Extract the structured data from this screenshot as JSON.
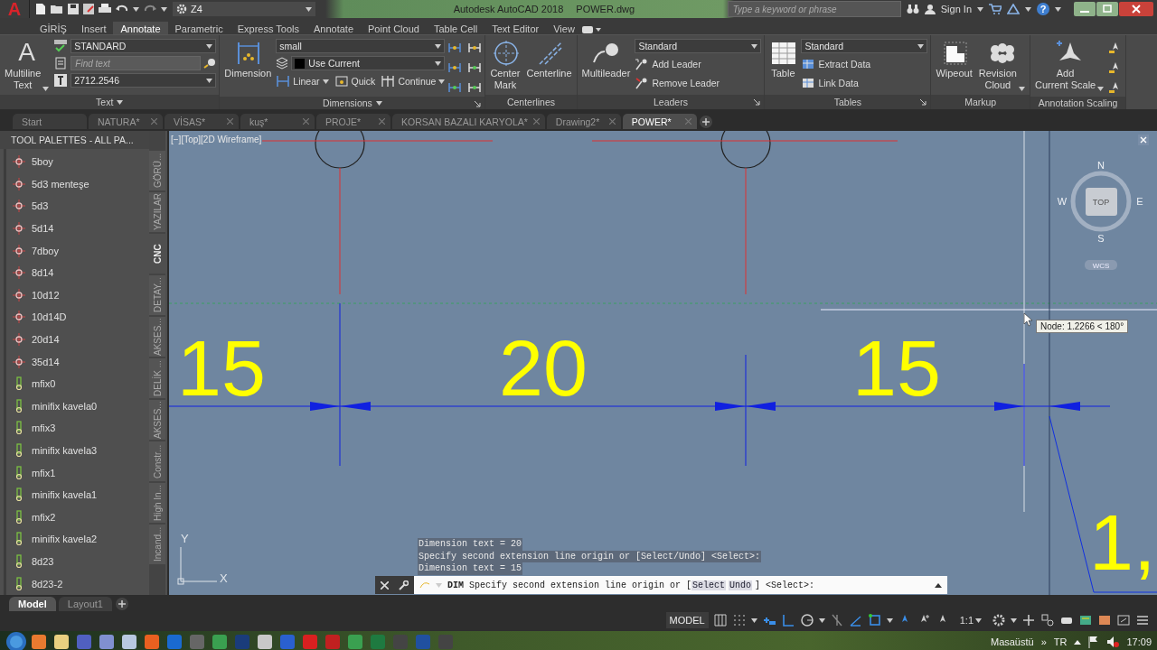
{
  "title_bar": {
    "app_button": "A",
    "workspace": "Z4",
    "title": "Autodesk AutoCAD 2018",
    "file": "POWER.dwg",
    "search": {
      "placeholder": "Type a keyword or phrase"
    },
    "sign_in": "Sign In",
    "help": "?"
  },
  "ribbon_tabs": [
    {
      "label": "GİRİŞ",
      "selected": false
    },
    {
      "label": "Insert",
      "selected": false
    },
    {
      "label": "Annotate",
      "selected": true
    },
    {
      "label": "Parametric",
      "selected": false
    },
    {
      "label": "Express Tools",
      "selected": false
    },
    {
      "label": "Annotate",
      "selected": false
    },
    {
      "label": "Point Cloud",
      "selected": false
    },
    {
      "label": "Table Cell",
      "selected": false
    },
    {
      "label": "Text Editor",
      "selected": false
    },
    {
      "label": "View",
      "selected": false
    }
  ],
  "ribbon_panels": [
    {
      "title": "Text",
      "menu": true,
      "launcher": false,
      "groups": [
        {
          "kind": "large",
          "glyph": "A",
          "label": "Multiline\nText",
          "menu": true
        },
        {
          "kind": "stack",
          "leading_icons": true,
          "rows": [
            {
              "kind": "dropdown",
              "value": "STANDARD"
            },
            {
              "kind": "search",
              "placeholder": "Find text"
            },
            {
              "kind": "dropdown",
              "value": "2712.2546"
            }
          ]
        }
      ]
    },
    {
      "title": "Dimensions",
      "menu": true,
      "launcher": true,
      "groups": [
        {
          "kind": "large",
          "label": "Dimension",
          "menu": false
        },
        {
          "kind": "stack",
          "leading_icons": false,
          "rows": [
            {
              "kind": "dropdown",
              "value": "small"
            },
            {
              "kind": "dropdown",
              "value": "Use Current",
              "color": "#000000"
            },
            {
              "kind": "tools",
              "items": [
                {
                  "label": "Linear",
                  "menu": true
                },
                {
                  "label": "Quick",
                  "menu": false
                },
                {
                  "label": "Continue",
                  "menu": true
                }
              ]
            }
          ]
        },
        {
          "kind": "icon_grid"
        }
      ]
    },
    {
      "title": "Centerlines",
      "menu": false,
      "launcher": false,
      "groups": [
        {
          "kind": "large",
          "label": "Center\nMark",
          "menu": false
        },
        {
          "kind": "large",
          "label": "Centerline",
          "menu": false
        }
      ]
    },
    {
      "title": "Leaders",
      "menu": false,
      "launcher": true,
      "groups": [
        {
          "kind": "large",
          "label": "Multileader",
          "menu": false
        },
        {
          "kind": "stack",
          "leading_icons": false,
          "rows": [
            {
              "kind": "dropdown",
              "value": "Standard"
            },
            {
              "kind": "tools",
              "items": [
                {
                  "label": "Add Leader",
                  "menu": false
                }
              ]
            },
            {
              "kind": "tools",
              "items": [
                {
                  "label": "Remove Leader",
                  "menu": false
                }
              ]
            }
          ]
        }
      ]
    },
    {
      "title": "Tables",
      "menu": false,
      "launcher": true,
      "groups": [
        {
          "kind": "large",
          "label": "Table",
          "menu": false
        },
        {
          "kind": "stack",
          "leading_icons": false,
          "rows": [
            {
              "kind": "dropdown",
              "value": "Standard"
            },
            {
              "kind": "tools",
              "items": [
                {
                  "label": "Extract Data",
                  "menu": false
                }
              ]
            },
            {
              "kind": "tools",
              "items": [
                {
                  "label": "Link Data",
                  "menu": false
                }
              ]
            }
          ]
        }
      ]
    },
    {
      "title": "Markup",
      "menu": false,
      "launcher": false,
      "groups": [
        {
          "kind": "large",
          "label": "Wipeout",
          "menu": false
        },
        {
          "kind": "large",
          "label": "Revision\nCloud",
          "menu": true
        }
      ]
    },
    {
      "title": "Annotation Scaling",
      "menu": false,
      "launcher": false,
      "groups": [
        {
          "kind": "large",
          "label": "Add\nCurrent Scale",
          "menu": true
        },
        {
          "kind": "icon_column"
        }
      ]
    }
  ],
  "file_tabs": [
    {
      "label": "Start",
      "selected": false
    },
    {
      "label": "NATURA*",
      "selected": false
    },
    {
      "label": "VİSAS*",
      "selected": false
    },
    {
      "label": "kuş*",
      "selected": false
    },
    {
      "label": "PROJE*",
      "selected": false
    },
    {
      "label": "KORSAN BAZALI KARYOLA*",
      "selected": false
    },
    {
      "label": "Drawing2*",
      "selected": false
    },
    {
      "label": "POWER*",
      "selected": true
    }
  ],
  "tool_palette": {
    "title": "TOOL PALETTES - ALL PA...",
    "items": [
      {
        "label": "5boy",
        "kind": "hole"
      },
      {
        "label": "5d3 menteşe",
        "kind": "hole"
      },
      {
        "label": "5d3",
        "kind": "hole"
      },
      {
        "label": "5d14",
        "kind": "hole"
      },
      {
        "label": "7dboy",
        "kind": "hole"
      },
      {
        "label": "8d14",
        "kind": "hole"
      },
      {
        "label": "10d12",
        "kind": "hole"
      },
      {
        "label": "10d14D",
        "kind": "hole"
      },
      {
        "label": "20d14",
        "kind": "hole"
      },
      {
        "label": "35d14",
        "kind": "hole"
      },
      {
        "label": "mfix0",
        "kind": "fitting"
      },
      {
        "label": "minifix kavela0",
        "kind": "fitting"
      },
      {
        "label": "mfix3",
        "kind": "fitting"
      },
      {
        "label": "minifix kavela3",
        "kind": "fitting"
      },
      {
        "label": "mfix1",
        "kind": "fitting"
      },
      {
        "label": "minifix kavela1",
        "kind": "fitting"
      },
      {
        "label": "mfix2",
        "kind": "fitting"
      },
      {
        "label": "minifix kavela2",
        "kind": "fitting"
      },
      {
        "label": "8d23",
        "kind": "fitting"
      },
      {
        "label": "8d23-2",
        "kind": "fitting"
      }
    ],
    "tabs": [
      {
        "label": "GÖRÜ...",
        "selected": false
      },
      {
        "label": "YAZILAR",
        "selected": false
      },
      {
        "label": "CNC",
        "selected": true
      },
      {
        "label": "DETAY...",
        "selected": false
      },
      {
        "label": "AKSES...",
        "selected": false
      },
      {
        "label": "DELİK ...",
        "selected": false
      },
      {
        "label": "AKSES...",
        "selected": false
      },
      {
        "label": "Constr...",
        "selected": false
      },
      {
        "label": "High In...",
        "selected": false
      },
      {
        "label": "Incand...",
        "selected": false
      }
    ]
  },
  "viewport": {
    "label": "[−][Top][2D Wireframe]",
    "dimension_texts": [
      "15",
      "20",
      "15",
      "1,"
    ],
    "viewcube": {
      "north": "N",
      "west": "W",
      "east": "E",
      "south": "S",
      "face": "TOP",
      "ucs": "WCS"
    },
    "tooltip": "Node: 1.2266 < 180°",
    "ucs_axes": {
      "x": "X",
      "y": "Y"
    }
  },
  "command_line": {
    "history": [
      "Dimension text = 20",
      "Specify second extension line origin or [Select/Undo] <Select>:",
      "Dimension text = 15"
    ],
    "prompt": {
      "command": "DIM",
      "text": "Specify second extension line origin or [",
      "options": [
        "Select",
        "Undo"
      ],
      "suffix": "] <Select>:"
    }
  },
  "layout_tabs": [
    {
      "label": "Model",
      "selected": true
    },
    {
      "label": "Layout1",
      "selected": false
    }
  ],
  "status_bar": {
    "space": "MODEL",
    "scale": "1:1"
  },
  "taskbar": {
    "toolbar": "Masaüstü",
    "chevron": "»",
    "language": "TR",
    "clock": "17:09"
  }
}
